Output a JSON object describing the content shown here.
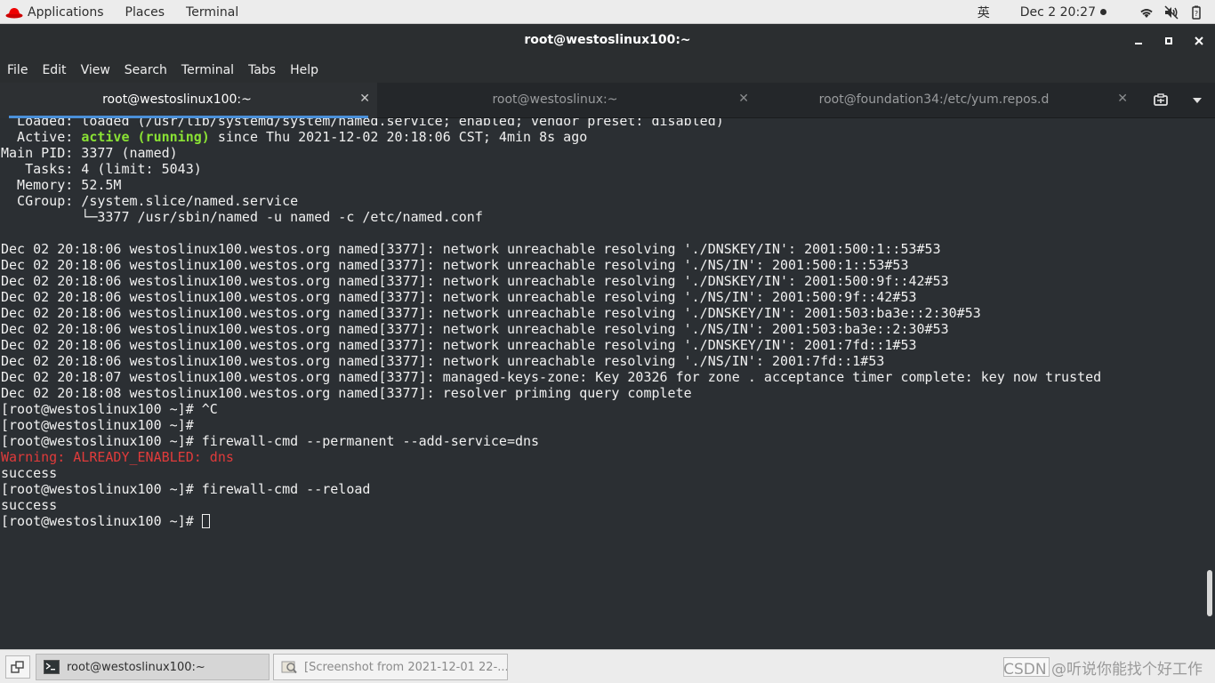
{
  "topbar": {
    "applications": "Applications",
    "places": "Places",
    "terminal": "Terminal",
    "ime": "英",
    "datetime": "Dec 2  20:27",
    "icons": [
      "wifi-icon",
      "volume-icon",
      "battery-icon"
    ]
  },
  "window": {
    "title": "root@westoslinux100:~",
    "buttons": [
      "minimize",
      "maximize",
      "close"
    ]
  },
  "menu": [
    "File",
    "Edit",
    "View",
    "Search",
    "Terminal",
    "Tabs",
    "Help"
  ],
  "tabs": [
    {
      "label": "root@westoslinux100:~",
      "active": true
    },
    {
      "label": "root@westoslinux:~",
      "active": false
    },
    {
      "label": "root@foundation34:/etc/yum.repos.d",
      "active": false
    }
  ],
  "terminal": {
    "lines": [
      "  Loaded: loaded (/usr/lib/systemd/system/named.service; enabled; vendor preset: disabled)",
      "  Active: ",
      "Main PID: 3377 (named)",
      "   Tasks: 4 (limit: 5043)",
      "  Memory: 52.5M",
      "  CGroup: /system.slice/named.service",
      "          └─3377 /usr/sbin/named -u named -c /etc/named.conf",
      "",
      "Dec 02 20:18:06 westoslinux100.westos.org named[3377]: network unreachable resolving './DNSKEY/IN': 2001:500:1::53#53",
      "Dec 02 20:18:06 westoslinux100.westos.org named[3377]: network unreachable resolving './NS/IN': 2001:500:1::53#53",
      "Dec 02 20:18:06 westoslinux100.westos.org named[3377]: network unreachable resolving './DNSKEY/IN': 2001:500:9f::42#53",
      "Dec 02 20:18:06 westoslinux100.westos.org named[3377]: network unreachable resolving './NS/IN': 2001:500:9f::42#53",
      "Dec 02 20:18:06 westoslinux100.westos.org named[3377]: network unreachable resolving './DNSKEY/IN': 2001:503:ba3e::2:30#53",
      "Dec 02 20:18:06 westoslinux100.westos.org named[3377]: network unreachable resolving './NS/IN': 2001:503:ba3e::2:30#53",
      "Dec 02 20:18:06 westoslinux100.westos.org named[3377]: network unreachable resolving './DNSKEY/IN': 2001:7fd::1#53",
      "Dec 02 20:18:06 westoslinux100.westos.org named[3377]: network unreachable resolving './NS/IN': 2001:7fd::1#53",
      "Dec 02 20:18:07 westoslinux100.westos.org named[3377]: managed-keys-zone: Key 20326 for zone . acceptance timer complete: key now trusted",
      "Dec 02 20:18:08 westoslinux100.westos.org named[3377]: resolver priming query complete",
      "[root@westoslinux100 ~]# ^C",
      "[root@westoslinux100 ~]# ",
      "[root@westoslinux100 ~]# firewall-cmd --permanent --add-service=dns",
      "Warning: ALREADY_ENABLED: dns",
      "success",
      "[root@westoslinux100 ~]# firewall-cmd --reload",
      "success",
      "[root@westoslinux100 ~]# "
    ],
    "active_status": "active (running)",
    "active_since": " since Thu 2021-12-02 20:18:06 CST; 4min 8s ago",
    "colors": {
      "background": "#2b2f33",
      "text": "#f0f0f0",
      "green": "#8ae234",
      "red": "#e03b3b"
    }
  },
  "taskbar": {
    "tasks": [
      {
        "label": "root@westoslinux100:~",
        "active": true
      },
      {
        "label": "[Screenshot from 2021-12-01 22-...",
        "active": false
      }
    ],
    "watermark": "CSDN @听说你能找个好工作"
  }
}
